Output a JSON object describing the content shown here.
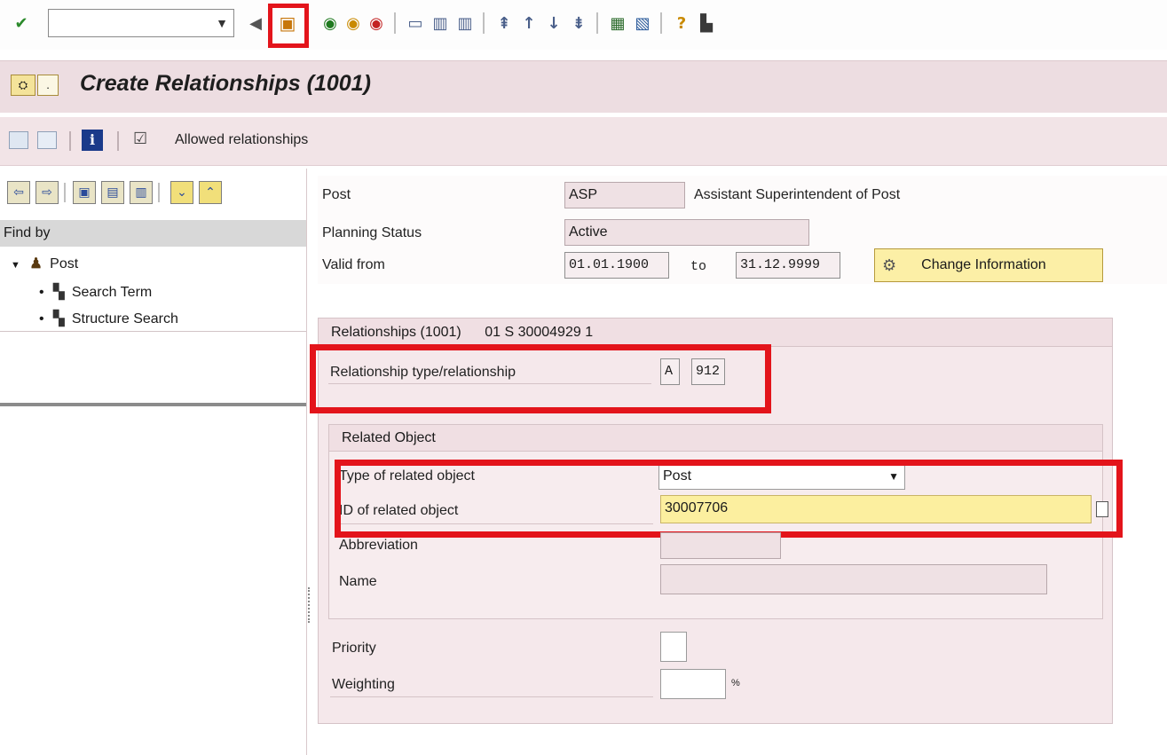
{
  "toolbar": {
    "command_value": "",
    "icons": [
      "check-icon",
      "dropdown-icon",
      "back-arrow-icon",
      "save-icon",
      "back-icon",
      "exit-icon",
      "cancel-icon",
      "print-icon",
      "find-icon",
      "find-next-icon",
      "first-page-icon",
      "previous-page-icon",
      "next-page-icon",
      "last-page-icon",
      "create-session-icon",
      "shortcut-icon",
      "help-icon",
      "customize-layout-icon"
    ]
  },
  "title": "Create Relationships (1001)",
  "app_toolbar": {
    "allowed_label": "Allowed relationships"
  },
  "nav": {
    "find_by": "Find by",
    "tree": {
      "root": "Post",
      "children": [
        "Search Term",
        "Structure Search"
      ]
    }
  },
  "header": {
    "post_label": "Post",
    "post_code": "ASP",
    "post_name": "Assistant Superintendent of Post",
    "planning_status_label": "Planning Status",
    "planning_status_value": "Active",
    "valid_from_label": "Valid from",
    "valid_from_value": "01.01.1900",
    "to_label": "to",
    "valid_to_value": "31.12.9999",
    "change_info_label": "Change Information"
  },
  "relationships": {
    "group_title": "Relationships (1001)",
    "group_key": "01 S  30004929 1",
    "type_label": "Relationship type/relationship",
    "type_value": "A",
    "relationship_value": "912"
  },
  "related_object": {
    "group_title": "Related Object",
    "type_label": "Type of related object",
    "type_value": "Post",
    "id_label": "ID of related object",
    "id_value": "30007706",
    "abbreviation_label": "Abbreviation",
    "abbreviation_value": "",
    "name_label": "Name",
    "name_value": ""
  },
  "extra": {
    "priority_label": "Priority",
    "priority_value": "",
    "weighting_label": "Weighting",
    "weighting_value": "",
    "weighting_unit": "%"
  },
  "colors": {
    "highlight_red": "#e3141b",
    "title_bar": "#eddde1",
    "input_required": "#fcef9f"
  }
}
